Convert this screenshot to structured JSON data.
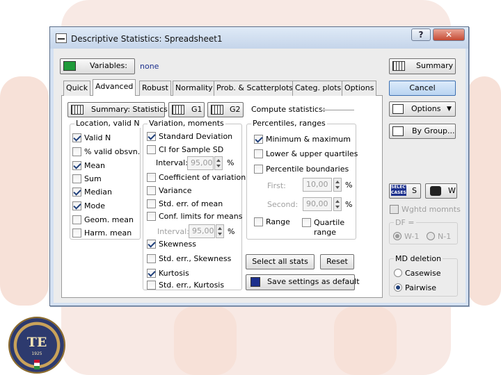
{
  "dialog": {
    "title": "Descriptive Statistics: Spreadsheet1",
    "help_label": "?",
    "close_label": "✕"
  },
  "variables": {
    "label": "Variables:",
    "value": "none"
  },
  "right_buttons": {
    "summary": "Summary",
    "cancel": "Cancel",
    "options": "Options",
    "by_group": "By Group...",
    "select_cases": "SELECT CASES",
    "s": "S",
    "w": "W"
  },
  "tabs": [
    "Quick",
    "Advanced",
    "Robust",
    "Normality",
    "Prob. & Scatterplots",
    "Categ. plots",
    "Options"
  ],
  "active_tab": "Advanced",
  "top_row": {
    "summary_statistics": "Summary: Statistics",
    "g1": "G1",
    "g2": "G2",
    "compute_statistics": "Compute statistics:"
  },
  "location": {
    "title": "Location, valid N",
    "items": [
      {
        "label": "Valid N",
        "checked": true
      },
      {
        "label": "% valid obsvn.",
        "checked": false
      },
      {
        "label": "Mean",
        "checked": true
      },
      {
        "label": "Sum",
        "checked": false
      },
      {
        "label": "Median",
        "checked": true
      },
      {
        "label": "Mode",
        "checked": true
      },
      {
        "label": "Geom. mean",
        "checked": false
      },
      {
        "label": "Harm. mean",
        "checked": false
      }
    ]
  },
  "variation": {
    "title": "Variation, moments",
    "std_dev": "Standard Deviation",
    "ci_sd": "CI for Sample SD",
    "interval_label": "Interval:",
    "interval_value": "95,00",
    "interval_unit": "%",
    "coef_var": "Coefficient of variation",
    "variance": "Variance",
    "std_err_mean": "Std. err. of mean",
    "conf_limits": "Conf. limits for means",
    "interval2_label": "Interval:",
    "interval2_value": "95,00",
    "interval2_unit": "%",
    "skewness": "Skewness",
    "std_err_skew": "Std. err., Skewness",
    "kurtosis": "Kurtosis",
    "std_err_kurt": "Std. err., Kurtosis"
  },
  "percentiles": {
    "title": "Percentiles, ranges",
    "min_max": "Minimum & maximum",
    "lower_upper": "Lower & upper quartiles",
    "boundaries": "Percentile boundaries",
    "first_label": "First:",
    "first_value": "10,00",
    "first_unit": "%",
    "second_label": "Second:",
    "second_value": "90,00",
    "second_unit": "%",
    "range": "Range",
    "quartile_range_1": "Quartile",
    "quartile_range_2": "range"
  },
  "bottom_buttons": {
    "select_all": "Select all stats",
    "reset": "Reset",
    "save_default": "Save settings as default"
  },
  "weights": {
    "wghtd": "Wghtd momnts",
    "df_label": "DF =",
    "w1": "W-1",
    "n1": "N-1"
  },
  "md_deletion": {
    "title": "MD deletion",
    "casewise": "Casewise",
    "pairwise": "Pairwise"
  },
  "logo": {
    "text": "TE",
    "year": "1925"
  }
}
